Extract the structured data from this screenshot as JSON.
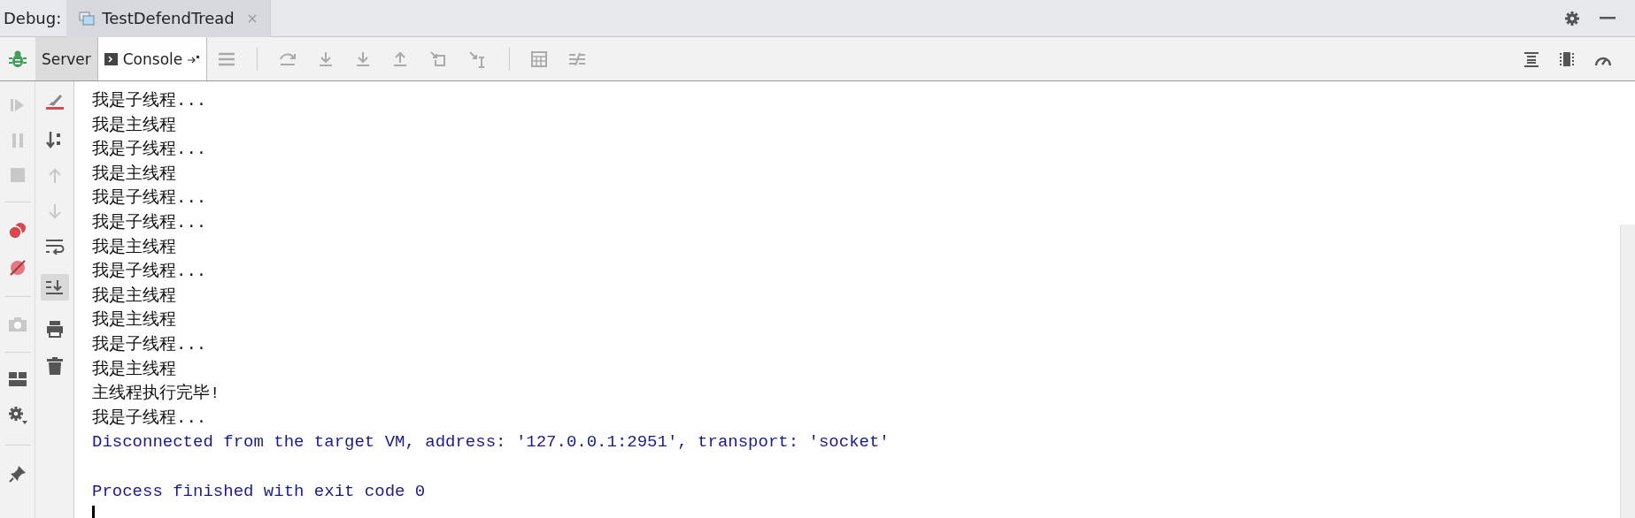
{
  "debug_bar": {
    "label": "Debug:",
    "tabs": [
      {
        "label": "TestDefendTread",
        "selected": true
      }
    ]
  },
  "toolbar": {
    "tabs": [
      {
        "label": "Server",
        "selected": false
      },
      {
        "label": "Console",
        "selected": true
      }
    ]
  },
  "console_tools": {
    "scroll_to_end_on": true
  },
  "console": {
    "lines": [
      {
        "kind": "stdout",
        "text": "我是子线程..."
      },
      {
        "kind": "stdout",
        "text": "我是主线程"
      },
      {
        "kind": "stdout",
        "text": "我是子线程..."
      },
      {
        "kind": "stdout",
        "text": "我是主线程"
      },
      {
        "kind": "stdout",
        "text": "我是子线程..."
      },
      {
        "kind": "stdout",
        "text": "我是子线程..."
      },
      {
        "kind": "stdout",
        "text": "我是主线程"
      },
      {
        "kind": "stdout",
        "text": "我是子线程..."
      },
      {
        "kind": "stdout",
        "text": "我是主线程"
      },
      {
        "kind": "stdout",
        "text": "我是主线程"
      },
      {
        "kind": "stdout",
        "text": "我是子线程..."
      },
      {
        "kind": "stdout",
        "text": "我是主线程"
      },
      {
        "kind": "stdout",
        "text": "主线程执行完毕!"
      },
      {
        "kind": "stdout",
        "text": "我是子线程..."
      },
      {
        "kind": "system",
        "text": "Disconnected from the target VM, address: '127.0.0.1:2951', transport: 'socket'"
      },
      {
        "kind": "blank"
      },
      {
        "kind": "system",
        "text": "Process finished with exit code 0"
      }
    ]
  }
}
